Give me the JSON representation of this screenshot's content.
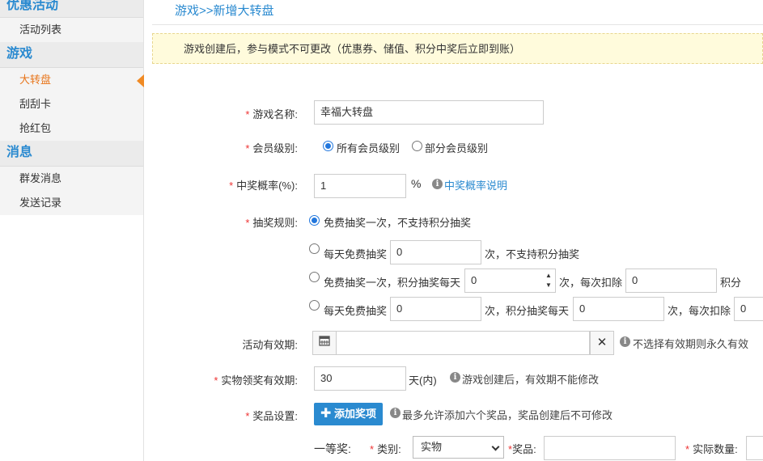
{
  "sidebar": {
    "sections": [
      {
        "title": "优惠活动",
        "items": [
          "活动列表"
        ]
      },
      {
        "title": "游戏",
        "items": [
          "大转盘",
          "刮刮卡",
          "抢红包"
        ]
      },
      {
        "title": "消息",
        "items": [
          "群发消息",
          "发送记录"
        ]
      }
    ],
    "active_item": "大转盘"
  },
  "breadcrumb": "游戏>>新增大转盘",
  "notice": "游戏创建后，参与模式不可更改（优惠券、储值、积分中奖后立即到账）",
  "form": {
    "game_name": {
      "label": "游戏名称:",
      "value": "幸福大转盘"
    },
    "member_level": {
      "label": "会员级别:",
      "options": [
        "所有会员级别",
        "部分会员级别"
      ],
      "selected": "所有会员级别"
    },
    "win_rate": {
      "label": "中奖概率(%):",
      "value": "1",
      "unit": "%",
      "help_link": "中奖概率说明"
    },
    "draw_rules": {
      "label": "抽奖规则:",
      "rule1": "免费抽奖一次，不支持积分抽奖",
      "rule2_prefix": "每天免费抽奖",
      "rule2_value": "0",
      "rule2_suffix": "次，不支持积分抽奖",
      "rule3_prefix": "免费抽奖一次，积分抽奖每天",
      "rule3_value": "0",
      "rule3_mid": "次，每次扣除",
      "rule3_points": "0",
      "rule3_suffix": "积分",
      "rule4_prefix": "每天免费抽奖",
      "rule4_value": "0",
      "rule4_mid": "次，积分抽奖每天",
      "rule4_value2": "0",
      "rule4_mid2": "次，每次扣除",
      "rule4_points": "0",
      "selected": 1
    },
    "valid_period": {
      "label": "活动有效期:",
      "value": "",
      "hint": "不选择有效期则永久有效"
    },
    "prize_valid": {
      "label": "实物领奖有效期:",
      "value": "30",
      "unit": "天(内)",
      "hint": "游戏创建后，有效期不能修改"
    },
    "prize_settings": {
      "label": "奖品设置:",
      "add_button": "添加奖项",
      "hint": "最多允许添加六个奖品，奖品创建后不可修改"
    },
    "first_prize": {
      "title": "一等奖:",
      "category_label": "类别:",
      "category_value": "实物",
      "prize_label": "奖品:",
      "prize_value": "",
      "qty_label": "实际数量:",
      "qty_value": ""
    }
  },
  "colors": {
    "accent": "#2a8ad0",
    "active": "#e8751a",
    "required": "#ee3333",
    "notice_bg": "#fffbdc"
  }
}
